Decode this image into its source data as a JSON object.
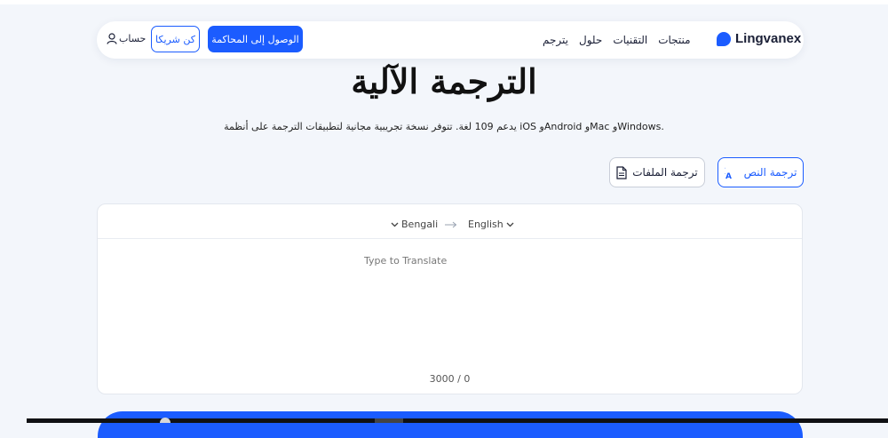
{
  "brand": {
    "name": "Lingvanex",
    "color": "#1b5cff"
  },
  "nav": {
    "links": [
      "منتجات",
      "التقنيات",
      "حلول",
      "يترجم"
    ]
  },
  "actions": {
    "access_label": "الوصول إلى المحاكمة",
    "partner_label": "كن شريكا",
    "account_label": "حساب"
  },
  "hero": {
    "title": "الترجمة الآلية",
    "subtitle": "يدعم 109 لغة. تتوفر نسخة تجريبية مجانية لتطبيقات الترجمة على أنظمة iOS وAndroid وMac وWindows."
  },
  "modes": {
    "text_label": "ترجمة النص",
    "text_icon": "translate-icon",
    "files_label": "ترجمة الملفات",
    "files_icon": "document-icon"
  },
  "translator": {
    "source_lang": "Bengali",
    "target_lang": "English",
    "swap_icon": "arrow-right-icon",
    "placeholder": "Type to Translate",
    "value": "",
    "char_count": "3000 / 0"
  }
}
